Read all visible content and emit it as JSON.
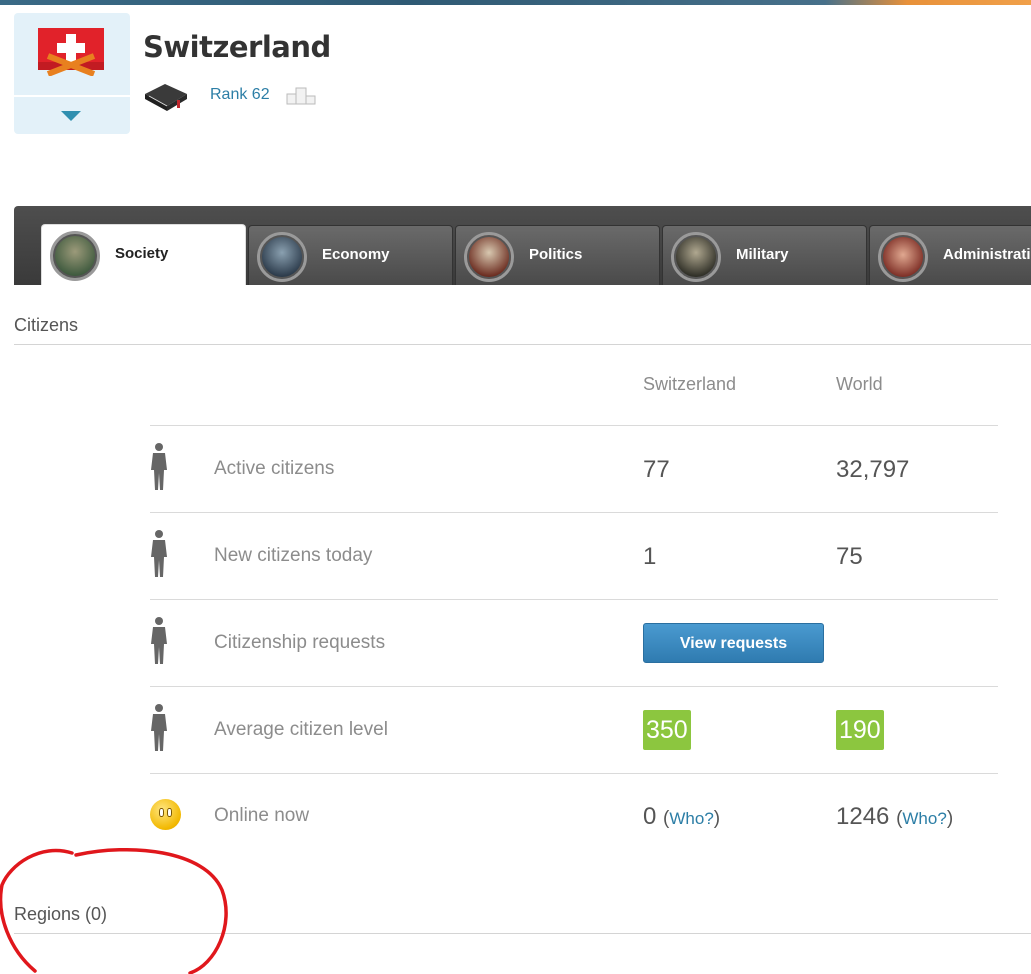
{
  "country": {
    "name": "Switzerland",
    "rank_label": "Rank 62"
  },
  "tabs": [
    {
      "label": "Society",
      "active": true
    },
    {
      "label": "Economy",
      "active": false
    },
    {
      "label": "Politics",
      "active": false
    },
    {
      "label": "Military",
      "active": false
    },
    {
      "label": "Administration",
      "active": false
    }
  ],
  "citizens": {
    "section_title": "Citizens",
    "columns": {
      "country": "Switzerland",
      "world": "World"
    },
    "rows": {
      "active": {
        "label": "Active citizens",
        "country": "77",
        "world": "32,797"
      },
      "new_today": {
        "label": "New citizens today",
        "country": "1",
        "world": "75"
      },
      "requests": {
        "label": "Citizenship requests",
        "button": "View requests"
      },
      "avg_level": {
        "label": "Average citizen level",
        "country": "350",
        "world": "190"
      },
      "online": {
        "label": "Online now",
        "country": "0",
        "world": "1246",
        "who_link": "Who?"
      }
    }
  },
  "regions": {
    "section_title": "Regions (0)"
  },
  "colors": {
    "accent_link": "#2c7ea6",
    "level_badge": "#8cc63f",
    "button": "#2f7bb0",
    "annotation": "#e0171c"
  },
  "icons": [
    "flag-icon",
    "chevron-down-icon",
    "book-icon",
    "rank-podium-icon",
    "person-icon",
    "smiley-icon"
  ]
}
